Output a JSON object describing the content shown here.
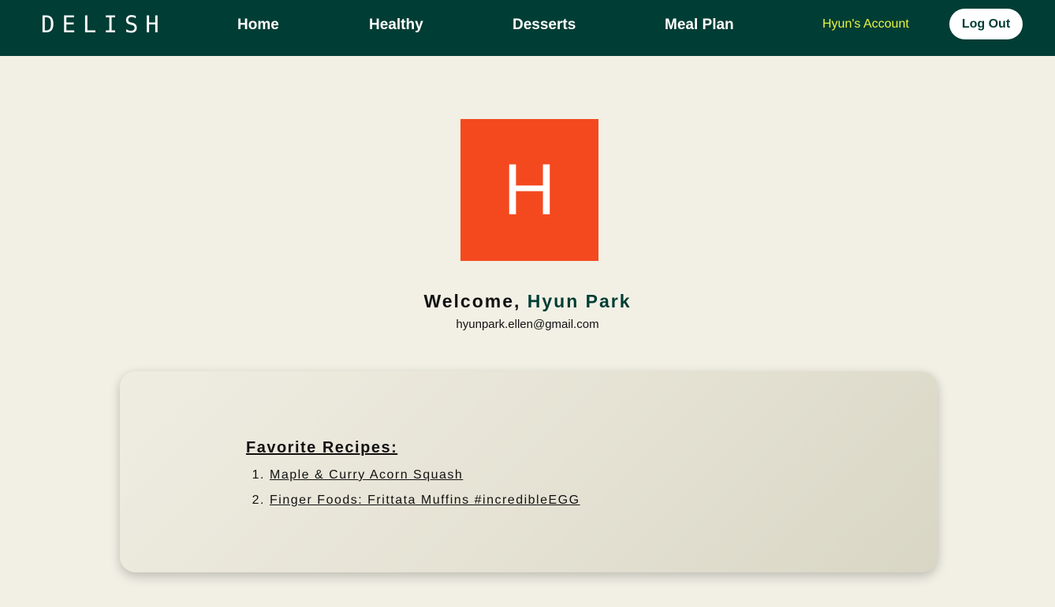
{
  "navbar": {
    "logo": "DELISH",
    "links": [
      {
        "label": "Home"
      },
      {
        "label": "Healthy"
      },
      {
        "label": "Desserts"
      },
      {
        "label": "Meal Plan"
      }
    ],
    "account_label": "Hyun's Account",
    "logout_label": "Log Out",
    "background_color": "#003d34",
    "account_color": "#e6f542"
  },
  "profile": {
    "avatar_letter": "H",
    "avatar_color": "#f4491f",
    "welcome_prefix": "Welcome,",
    "user_name": "Hyun Park",
    "email": "hyunpark.ellen@gmail.com"
  },
  "favorites": {
    "title": "Favorite Recipes:",
    "recipes": [
      {
        "number": "1.",
        "name": "Maple & Curry Acorn Squash"
      },
      {
        "number": "2.",
        "name": "Finger Foods: Frittata Muffins #incredibleEGG"
      }
    ]
  }
}
